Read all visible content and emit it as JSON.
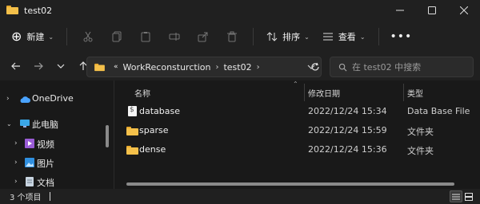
{
  "window": {
    "title": "test02"
  },
  "toolbar": {
    "new_label": "新建",
    "sort_label": "排序",
    "view_label": "查看",
    "more_label": "•••"
  },
  "address": {
    "prefix": "«",
    "crumbs": [
      "WorkReconsturction",
      "test02"
    ],
    "separator": "›"
  },
  "search": {
    "placeholder": "在 test02 中搜索"
  },
  "sidebar": {
    "items": [
      {
        "label": "OneDrive",
        "icon": "cloud-icon"
      },
      {
        "label": "此电脑",
        "icon": "computer-icon"
      },
      {
        "label": "视频",
        "icon": "video-icon"
      },
      {
        "label": "图片",
        "icon": "picture-icon"
      },
      {
        "label": "文档",
        "icon": "document-icon"
      }
    ]
  },
  "columns": {
    "name": "名称",
    "date": "修改日期",
    "type": "类型"
  },
  "files": [
    {
      "name": "database",
      "date": "2022/12/24 15:34",
      "type": "Data Base File",
      "icon": "database-file-icon"
    },
    {
      "name": "sparse",
      "date": "2022/12/24 15:59",
      "type": "文件夹",
      "icon": "folder-icon"
    },
    {
      "name": "dense",
      "date": "2022/12/24 15:36",
      "type": "文件夹",
      "icon": "folder-icon"
    }
  ],
  "status": {
    "item_count": "3 个项目"
  },
  "colors": {
    "background": "#202020",
    "content_bg": "#191919",
    "folder": "#f4c04a",
    "accent": "#4aa3ff"
  }
}
